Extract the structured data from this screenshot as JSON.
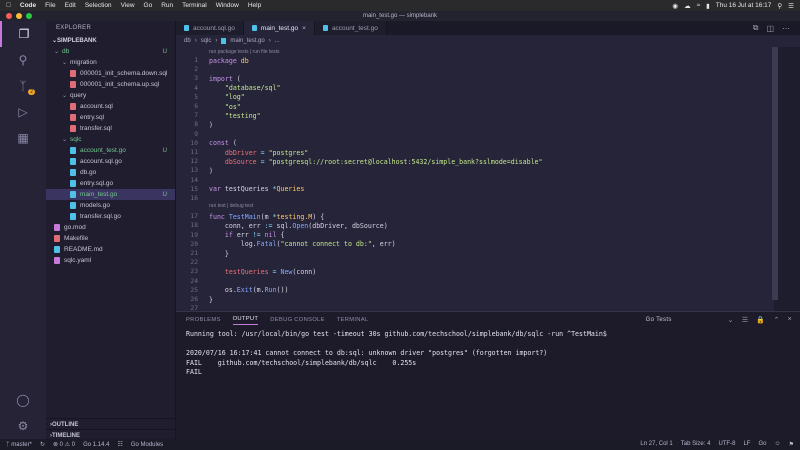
{
  "menubar": {
    "app": "Code",
    "items": [
      "File",
      "Edit",
      "Selection",
      "View",
      "Go",
      "Run",
      "Terminal",
      "Window",
      "Help"
    ],
    "clock": "Thu 16 Jul at 16:17"
  },
  "window": {
    "title": "main_test.go — simplebank"
  },
  "sidebar": {
    "header": "EXPLORER",
    "root": "SIMPLEBANK",
    "tree": [
      {
        "label": "db",
        "depth": 0,
        "folder": true,
        "green": true
      },
      {
        "label": "migration",
        "depth": 1,
        "folder": true
      },
      {
        "label": "000001_init_schema.down.sql",
        "depth": 2,
        "color": "#e06c75"
      },
      {
        "label": "000001_init_schema.up.sql",
        "depth": 2,
        "color": "#e06c75"
      },
      {
        "label": "query",
        "depth": 1,
        "folder": true
      },
      {
        "label": "account.sql",
        "depth": 2,
        "color": "#e06c75"
      },
      {
        "label": "entry.sql",
        "depth": 2,
        "color": "#e06c75"
      },
      {
        "label": "transfer.sql",
        "depth": 2,
        "color": "#e06c75"
      },
      {
        "label": "sqlc",
        "depth": 1,
        "folder": true,
        "green": true
      },
      {
        "label": "account_test.go",
        "depth": 2,
        "color": "#4fc1e9",
        "green": true,
        "status": "U"
      },
      {
        "label": "account.sql.go",
        "depth": 2,
        "color": "#4fc1e9"
      },
      {
        "label": "db.go",
        "depth": 2,
        "color": "#4fc1e9"
      },
      {
        "label": "entry.sql.go",
        "depth": 2,
        "color": "#4fc1e9"
      },
      {
        "label": "main_test.go",
        "depth": 2,
        "color": "#4fc1e9",
        "green": true,
        "status": "U",
        "selected": true
      },
      {
        "label": "models.go",
        "depth": 2,
        "color": "#4fc1e9"
      },
      {
        "label": "transfer.sql.go",
        "depth": 2,
        "color": "#4fc1e9"
      },
      {
        "label": "go.mod",
        "depth": 0,
        "color": "#c678dd"
      },
      {
        "label": "Makefile",
        "depth": 0,
        "color": "#e06c75"
      },
      {
        "label": "README.md",
        "depth": 0,
        "color": "#4fc1e9"
      },
      {
        "label": "sqlc.yaml",
        "depth": 0,
        "color": "#c678dd"
      }
    ],
    "outline": "OUTLINE",
    "timeline": "TIMELINE",
    "db_status": "U"
  },
  "tabs": [
    {
      "label": "account.sql.go",
      "active": false
    },
    {
      "label": "main_test.go",
      "active": true
    },
    {
      "label": "account_test.go",
      "active": false
    }
  ],
  "breadcrumb": [
    "db",
    "sqlc",
    "main_test.go",
    "..."
  ],
  "editor": {
    "lens_package": "run package tests | run file tests",
    "lens_test": "run test | debug test",
    "lines": [
      {
        "n": "1",
        "tokens": [
          [
            "package ",
            "kw"
          ],
          [
            "db",
            "ty"
          ]
        ]
      },
      {
        "n": "2",
        "tokens": []
      },
      {
        "n": "3",
        "tokens": [
          [
            "import ",
            "kw"
          ],
          [
            "(",
            ""
          ]
        ]
      },
      {
        "n": "4",
        "tokens": [
          [
            "    ",
            ""
          ],
          [
            "\"database/sql\"",
            "str"
          ]
        ]
      },
      {
        "n": "5",
        "tokens": [
          [
            "    ",
            ""
          ],
          [
            "\"log\"",
            "str"
          ]
        ]
      },
      {
        "n": "6",
        "tokens": [
          [
            "    ",
            ""
          ],
          [
            "\"os\"",
            "str"
          ]
        ]
      },
      {
        "n": "7",
        "tokens": [
          [
            "    ",
            ""
          ],
          [
            "\"testing\"",
            "str"
          ]
        ]
      },
      {
        "n": "8",
        "tokens": [
          [
            ")",
            ""
          ]
        ]
      },
      {
        "n": "9",
        "tokens": []
      },
      {
        "n": "10",
        "tokens": [
          [
            "const ",
            "kw"
          ],
          [
            "(",
            ""
          ]
        ]
      },
      {
        "n": "11",
        "tokens": [
          [
            "    ",
            ""
          ],
          [
            "dbDriver",
            "va"
          ],
          [
            " = ",
            "op"
          ],
          [
            "\"postgres\"",
            "str"
          ]
        ]
      },
      {
        "n": "12",
        "tokens": [
          [
            "    ",
            ""
          ],
          [
            "dbSource",
            "va"
          ],
          [
            " = ",
            "op"
          ],
          [
            "\"postgresql://root:secret@localhost:5432/simple_bank?sslmode=disable\"",
            "str"
          ]
        ]
      },
      {
        "n": "13",
        "tokens": [
          [
            ")",
            ""
          ]
        ]
      },
      {
        "n": "14",
        "tokens": []
      },
      {
        "n": "15",
        "tokens": [
          [
            "var ",
            "kw"
          ],
          [
            "testQueries ",
            ""
          ],
          [
            "*",
            "op"
          ],
          [
            "Queries",
            "ty"
          ]
        ]
      },
      {
        "n": "16",
        "tokens": []
      },
      {
        "n": "17",
        "tokens": [
          [
            "func ",
            "kw"
          ],
          [
            "TestMain",
            "fn"
          ],
          [
            "(m ",
            ""
          ],
          [
            "*",
            "op"
          ],
          [
            "testing.M",
            "ty"
          ],
          [
            ") {",
            ""
          ]
        ]
      },
      {
        "n": "18",
        "tokens": [
          [
            "    conn, err ",
            ""
          ],
          [
            ":= ",
            "op"
          ],
          [
            "sql.",
            ""
          ],
          [
            "Open",
            "fn"
          ],
          [
            "(dbDriver, dbSource)",
            ""
          ]
        ]
      },
      {
        "n": "19",
        "tokens": [
          [
            "    ",
            ""
          ],
          [
            "if ",
            "kw"
          ],
          [
            "err ",
            ""
          ],
          [
            "!= ",
            "op"
          ],
          [
            "nil ",
            "kw"
          ],
          [
            "{",
            ""
          ]
        ]
      },
      {
        "n": "20",
        "tokens": [
          [
            "        log.",
            ""
          ],
          [
            "Fatal",
            "fn"
          ],
          [
            "(",
            ""
          ],
          [
            "\"cannot connect to db:\"",
            "str"
          ],
          [
            ", err)",
            ""
          ]
        ]
      },
      {
        "n": "21",
        "tokens": [
          [
            "    }",
            ""
          ]
        ]
      },
      {
        "n": "22",
        "tokens": []
      },
      {
        "n": "23",
        "tokens": [
          [
            "    ",
            ""
          ],
          [
            "testQueries",
            "va"
          ],
          [
            " = ",
            "op"
          ],
          [
            "New",
            "fn"
          ],
          [
            "(conn)",
            ""
          ]
        ]
      },
      {
        "n": "24",
        "tokens": []
      },
      {
        "n": "25",
        "tokens": [
          [
            "    os.",
            ""
          ],
          [
            "Exit",
            "fn"
          ],
          [
            "(m.",
            ""
          ],
          [
            "Run",
            "fn"
          ],
          [
            "())",
            ""
          ]
        ]
      },
      {
        "n": "26",
        "tokens": [
          [
            "}",
            ""
          ]
        ]
      },
      {
        "n": "27",
        "tokens": []
      }
    ]
  },
  "panel": {
    "tabs": [
      "PROBLEMS",
      "OUTPUT",
      "DEBUG CONSOLE",
      "TERMINAL"
    ],
    "active_tab": "OUTPUT",
    "selector": "Go Tests",
    "output": [
      "Running tool: /usr/local/bin/go test -timeout 30s github.com/techschool/simplebank/db/sqlc -run ^TestMain$",
      "",
      "2020/07/16 16:17:41 cannot connect to db:sql: unknown driver \"postgres\" (forgotten import?)",
      "FAIL    github.com/techschool/simplebank/db/sqlc    0.255s",
      "FAIL"
    ]
  },
  "statusbar": {
    "branch": "master*",
    "problems": "⊗ 0  ⚠ 0",
    "go_version": "Go 1.14.4",
    "go_modules": "Go Modules",
    "position": "Ln 27, Col 1",
    "tab_size": "Tab Size: 4",
    "encoding": "UTF-8",
    "eol": "LF",
    "language": "Go"
  },
  "activity_badge": "2"
}
